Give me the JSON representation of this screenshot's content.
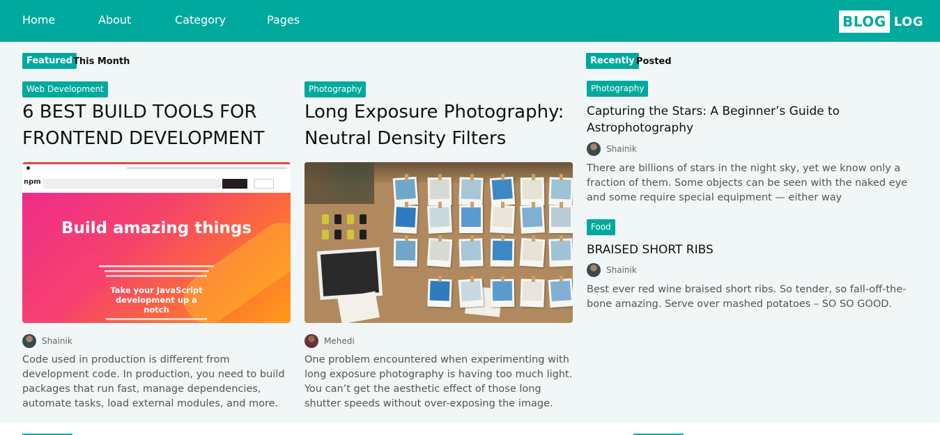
{
  "nav": {
    "links": [
      "Home",
      "About",
      "Category",
      "Pages"
    ],
    "logo_box": "BLOG",
    "logo_text": "LOG"
  },
  "featured": {
    "badge": "Featured",
    "suffix": "This Month",
    "posts": [
      {
        "category": "Web Development",
        "title": "6 BEST BUILD TOOLS FOR FRONTEND DEVELOPMENT",
        "author": "Shainik",
        "excerpt": "Code used in production is different from development code. In production, you need to build packages that run fast, manage dependencies, automate tasks, load external modules, and more.",
        "thumb": {
          "hero_title": "Build amazing things",
          "hero_sub": "Take your JavaScript development up a notch",
          "brand": "npm"
        }
      },
      {
        "category": "Photography",
        "title": "Long Exposure Photography: Neutral Density Filters",
        "author": "Mehedi",
        "excerpt": "One problem encountered when experimenting with long exposure photography is having too much light. You can’t get the aesthetic effect of those long shutter speeds without over-exposing the image."
      }
    ]
  },
  "recent": {
    "badge": "Recently",
    "suffix": "Posted",
    "posts": [
      {
        "category": "Photography",
        "title": "Capturing the Stars: A Beginner’s Guide to Astrophotography",
        "author": "Shainik",
        "excerpt": "There are billions of stars in the night sky, yet we know only a fraction of them. Some objects can be seen with the naked eye and some require special equipment — either way"
      },
      {
        "category": "Food",
        "title": "BRAISED SHORT RIBS",
        "author": "Shainik",
        "excerpt": "Best ever red wine braised short ribs. So tender, so fall-off-the-bone amazing. Serve over mashed potatoes – SO SO GOOD."
      }
    ]
  },
  "colors": {
    "brand": "#00a99d",
    "main_bg": "#f1f6f6"
  }
}
